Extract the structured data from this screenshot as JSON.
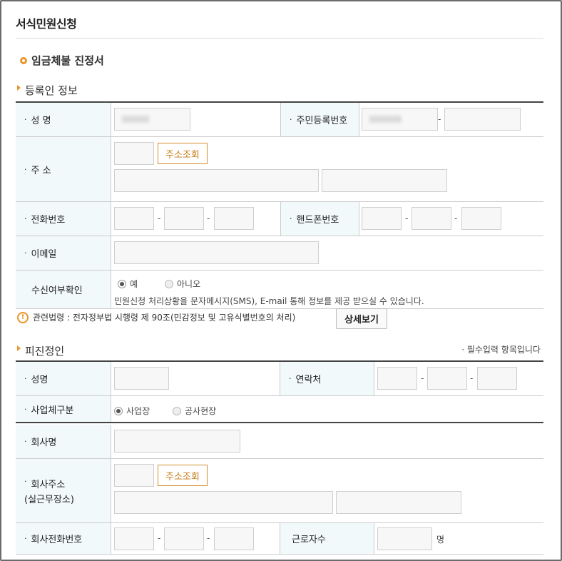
{
  "page": {
    "title": "서식민원신청"
  },
  "form": {
    "title": "임금체불 진정서"
  },
  "registrant": {
    "section_title": "등록인 정보",
    "name_label": "성 명",
    "rrn_label": "주민등록번호",
    "address_label": "주 소",
    "address_button": "주소조회",
    "phone_label": "전화번호",
    "mobile_label": "핸드폰번호",
    "email_label": "이메일",
    "receive_label": "수신여부확인",
    "receive_yes": "예",
    "receive_no": "아니오",
    "receive_note": "민원신청 처리상황을 문자메시지(SMS), E-mail 통해 정보를 제공 받으실 수 있습니다.",
    "dash": "-"
  },
  "law": {
    "text": "관련법령 : 전자정부법 시행령 제 90조(민감정보 및 고유식별번호의 처리)",
    "detail_button": "상세보기",
    "icon": "warning-circle-icon"
  },
  "respondent": {
    "section_title": "피진정인",
    "required_note": "· 필수입력 항목입니다",
    "name_label": "성명",
    "contact_label": "연락처",
    "business_type_label": "사업체구분",
    "business_option_1": "사업장",
    "business_option_2": "공사현장",
    "company_name_label": "회사명",
    "company_address_label": "회사주소",
    "company_address_sub": "(실근무장소)",
    "address_button": "주소조회",
    "company_phone_label": "회사전화번호",
    "workers_label": "근로자수",
    "workers_unit": "명",
    "dash": "-"
  },
  "colors": {
    "accent": "#e8962a",
    "header_bg": "#f2f9fb",
    "border": "#444444"
  }
}
